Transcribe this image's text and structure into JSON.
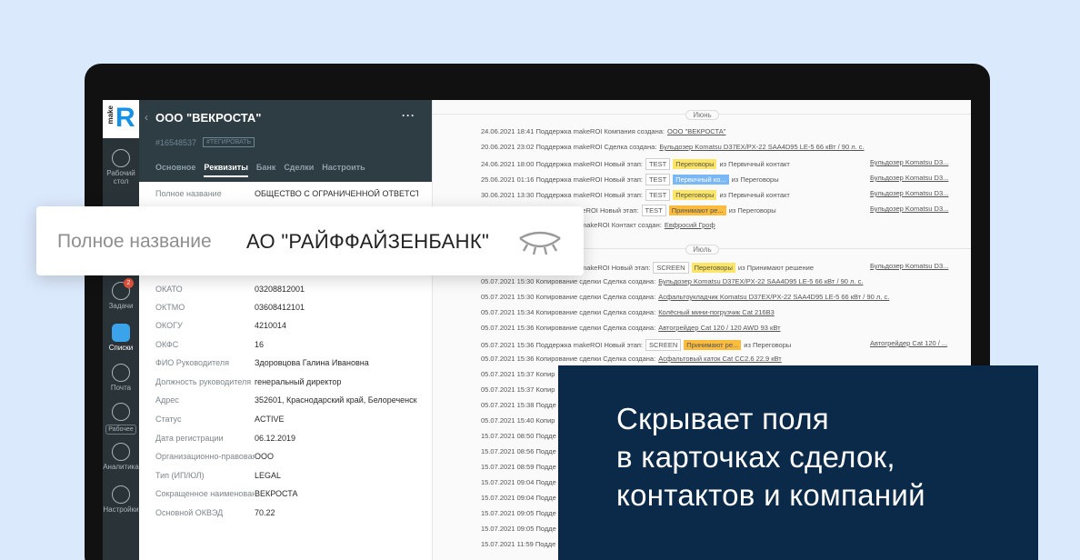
{
  "nav": {
    "logo_text": "make",
    "logo_letter": "R",
    "items": [
      {
        "label": "Рабочий стол",
        "icon": "dashboard-icon"
      },
      {
        "label": "Задачи",
        "icon": "tasks-icon",
        "badge": "2"
      },
      {
        "label": "Списки",
        "icon": "lists-icon",
        "active": true
      },
      {
        "label": "Почта",
        "icon": "mail-icon"
      },
      {
        "label": "Рабочее",
        "icon": "workspace-icon"
      },
      {
        "label": "Аналитика",
        "icon": "analytics-icon"
      },
      {
        "label": "Настройки",
        "icon": "settings-icon"
      }
    ]
  },
  "card": {
    "title": "ООО \"ВЕКРОСТА\"",
    "id": "#16548537",
    "tag_button": "#ТЕГИРОВАТЬ",
    "tabs": [
      "Основное",
      "Реквизиты",
      "Банк",
      "Сделки",
      "Настроить"
    ],
    "fields": [
      {
        "label": "Полное название",
        "value": "ОБЩЕСТВО С ОГРАНИЧЕННОЙ ОТВЕТСТВЕ"
      },
      {
        "label": "ОКАТО",
        "value": "03208812001"
      },
      {
        "label": "ОКТМО",
        "value": "03608412101"
      },
      {
        "label": "ОКОГУ",
        "value": "4210014"
      },
      {
        "label": "ОКФС",
        "value": "16"
      },
      {
        "label": "ФИО Руководителя",
        "value": "Здоровцова Галина Ивановна"
      },
      {
        "label": "Должность руководителя",
        "value": "генеральный директор"
      },
      {
        "label": "Адрес",
        "value": "352601, Краснодарский край, Белореченск"
      },
      {
        "label": "Статус",
        "value": "ACTIVE"
      },
      {
        "label": "Дата регистрации",
        "value": "06.12.2019"
      },
      {
        "label": "Организационно-правовая",
        "value": "ООО"
      },
      {
        "label": "Тип (ИП/ЮЛ)",
        "value": "LEGAL"
      },
      {
        "label": "Сокращенное наименование",
        "value": "ВЕКРОСТА"
      },
      {
        "label": "Основной ОКВЭД",
        "value": "70.22"
      }
    ]
  },
  "feed": {
    "months": [
      "Июнь",
      "Июль"
    ],
    "events": [
      {
        "text": "24.06.2021 18:41 Поддержка makeROI Компания создана:",
        "link": "ООО \"ВЕКРОСТА\""
      },
      {
        "text": "20.06.2021 23:02 Поддержка makeROI Сделка создана:",
        "link": "Бульдозер Komatsu D37EX/PX-22 SAA4D95 LE-5 66 кВт / 90 л. с."
      },
      {
        "text": "24.06.2021 18:00 Поддержка makeROI Новый этап:",
        "code": "TEST",
        "stage": "Переговоры",
        "stage_color": "y",
        "after": "из Первичный контакт",
        "right": "Бульдозер Komatsu D3..."
      },
      {
        "text": "25.06.2021 01:16 Поддержка makeROI Новый этап:",
        "code": "TEST",
        "stage": "Первичный ко...",
        "stage_color": "b",
        "after": "из Переговоры",
        "right": "Бульдозер Komatsu D3..."
      },
      {
        "text": "30.06.2021 13:30 Поддержка makeROI Новый этап:",
        "code": "TEST",
        "stage": "Переговоры",
        "stage_color": "y",
        "after": "из Первичный контакт",
        "right": "Бульдозер Komatsu D3..."
      },
      {
        "text": "Поддержка makeROI Новый этап:",
        "code": "TEST",
        "stage": "Принимают ре...",
        "stage_color": "o",
        "after": "из Переговоры",
        "right": "Бульдозер Komatsu D3..."
      },
      {
        "text": "makeROI Контакт создан:",
        "link": "Евфросий Гроф"
      },
      {
        "text": "makeROI Новый этап:",
        "code": "SCREEN",
        "stage": "Переговоры",
        "stage_color": "y",
        "after": "из Принимают решение",
        "right": "Бульдозер Komatsu D3..."
      },
      {
        "text": "05.07.2021 15:30 Копирование сделки Сделка создана:",
        "link": "Бульдозер Komatsu D37EX/PX-22 SAA4D95 LE-5 66 кВт / 90 л. с."
      },
      {
        "text": "05.07.2021 15:30 Копирование сделки Сделка создана:",
        "link": "Асфальтоукладчик Komatsu D37EX/PX-22 SAA4D95 LE-5 66 кВт / 90 л. с."
      },
      {
        "text": "05.07.2021 15:34 Копирование сделки Сделка создана:",
        "link": "Колёсный мини-погрузчик Cat 216B3"
      },
      {
        "text": "05.07.2021 15:36 Копирование сделки Сделка создана:",
        "link": "Автогрейдер Cat 120 / 120 AWD 93 кВт"
      },
      {
        "text": "05.07.2021 15:36 Поддержка makeROI Новый этап:",
        "code": "SCREEN",
        "stage": "Принимают ре...",
        "stage_color": "o",
        "after": "из Переговоры",
        "right": "Автогрейдер Cat 120 / ..."
      },
      {
        "text": "05.07.2021 15:36 Копирование сделки Сделка создана:",
        "link": "Асфальтовый каток Cat CC2.6 22.9 кВт"
      },
      {
        "text": "05.07.2021 15:37 Копир"
      },
      {
        "text": "05.07.2021 15:37 Копир"
      },
      {
        "text": "05.07.2021 15:38 Подде"
      },
      {
        "text": "05.07.2021 15:40 Копир"
      },
      {
        "text": "15.07.2021 08:50 Подде"
      },
      {
        "text": "15.07.2021 08:56 Подде"
      },
      {
        "text": "15.07.2021 08:59 Подде"
      },
      {
        "text": "15.07.2021 09:04 Подде"
      },
      {
        "text": "15.07.2021 09:04 Подде"
      },
      {
        "text": "15.07.2021 09:05 Подде"
      },
      {
        "text": "15.07.2021 09:05 Подде"
      },
      {
        "text": "15.07.2021 11:59 Подде"
      }
    ]
  },
  "overlay": {
    "label": "Полное название",
    "value": "АО \"РАЙФФАЙЗЕНБАНК\"",
    "icon": "closed-eye-icon"
  },
  "promo": {
    "lines": [
      "Скрывает поля",
      "в карточках сделок,",
      "контактов и компаний"
    ]
  },
  "colors": {
    "background": "#dbe9fc",
    "sidebar": "#2a3338",
    "card_header": "#2e3c44",
    "promo": "#0b2a4a",
    "accent": "#1592e6"
  }
}
